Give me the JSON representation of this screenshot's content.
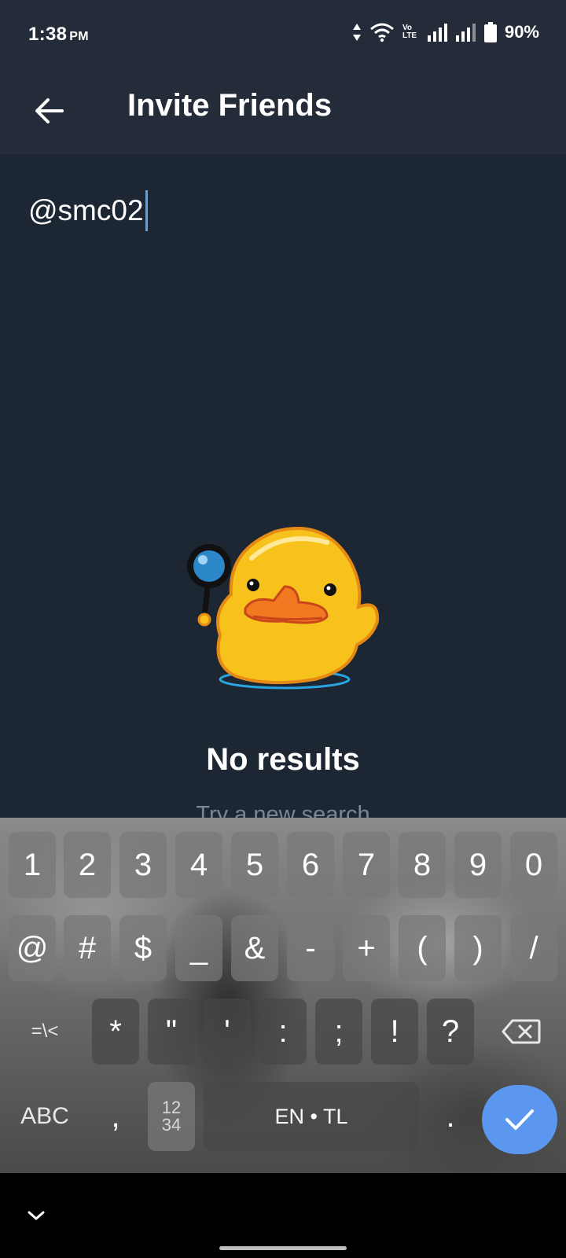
{
  "status_bar": {
    "time": "1:38",
    "ampm": "PM",
    "battery": "90%",
    "icons": [
      "data-arrows-icon",
      "wifi-icon",
      "volte-icon",
      "signal-icon",
      "signal-icon",
      "battery-icon"
    ],
    "volte_text": "Vo LTE"
  },
  "header": {
    "back_icon": "arrow-left-icon",
    "title": "Invite Friends"
  },
  "search": {
    "value": "@smc02"
  },
  "empty_state": {
    "sticker": "duck-magnifier-sticker",
    "title": "No results",
    "hint": "Try a new search"
  },
  "keyboard": {
    "row1": [
      "1",
      "2",
      "3",
      "4",
      "5",
      "6",
      "7",
      "8",
      "9",
      "0"
    ],
    "row2": [
      "@",
      "#",
      "$",
      "_",
      "&",
      "-",
      "+",
      "(",
      ")",
      "/"
    ],
    "row3_left": "=\\<",
    "row3": [
      "*",
      "\"",
      "'",
      ":",
      ";",
      "!",
      "?"
    ],
    "backspace_icon": "backspace-icon",
    "abc": "ABC",
    "comma": ",",
    "numpad_top": "12",
    "numpad_bottom": "34",
    "space": "EN • TL",
    "period": ".",
    "enter_icon": "checkmark-icon",
    "colors": {
      "enter": "#5b97ee"
    }
  },
  "nav_bar": {
    "collapse_icon": "chevron-down-icon"
  },
  "colors": {
    "background": "#1d2633",
    "header": "#242c39",
    "caret": "#5aa1e6",
    "hint": "#7a8796"
  }
}
